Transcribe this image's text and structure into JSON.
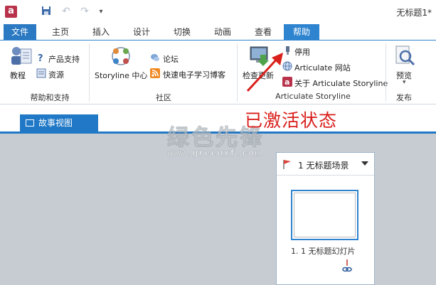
{
  "titlebar": {
    "app_logo_letter": "a",
    "doc_title": "无标题1*"
  },
  "tabs": [
    {
      "label": "文件",
      "state": "file"
    },
    {
      "label": "主页",
      "state": "normal"
    },
    {
      "label": "插入",
      "state": "normal"
    },
    {
      "label": "设计",
      "state": "normal"
    },
    {
      "label": "切换",
      "state": "normal"
    },
    {
      "label": "动画",
      "state": "normal"
    },
    {
      "label": "查看",
      "state": "normal"
    },
    {
      "label": "帮助",
      "state": "active"
    }
  ],
  "ribbon": {
    "help_group": {
      "label": "帮助和支持",
      "tutorial": "教程",
      "product_support": "产品支持",
      "resources": "资源"
    },
    "community_group": {
      "label": "社区",
      "storyline_center": "Storyline 中心",
      "forum": "论坛",
      "blog": "快速电子学习博客"
    },
    "storyline_group": {
      "label": "Articulate Storyline",
      "check_update": "检查更新",
      "deactivate": "停用",
      "website": "Articulate 网站",
      "about": "关于 Articulate Storyline"
    },
    "publish_group": {
      "label": "发布",
      "preview": "预览",
      "preview_caret": "▾"
    }
  },
  "story_view": {
    "tab_label": "故事视图"
  },
  "scene": {
    "title": "1 无标题场景",
    "slide_label": "1. 1 无标题幻灯片"
  },
  "annotation": {
    "text": "已激活状态",
    "color": "#d9201c"
  },
  "watermark": {
    "cn": "绿色先锋",
    "en": "www.greenxf.com"
  },
  "colors": {
    "accent": "#2f84d0",
    "file_tab": "#2b79c2",
    "canvas": "#c7ccd2"
  }
}
